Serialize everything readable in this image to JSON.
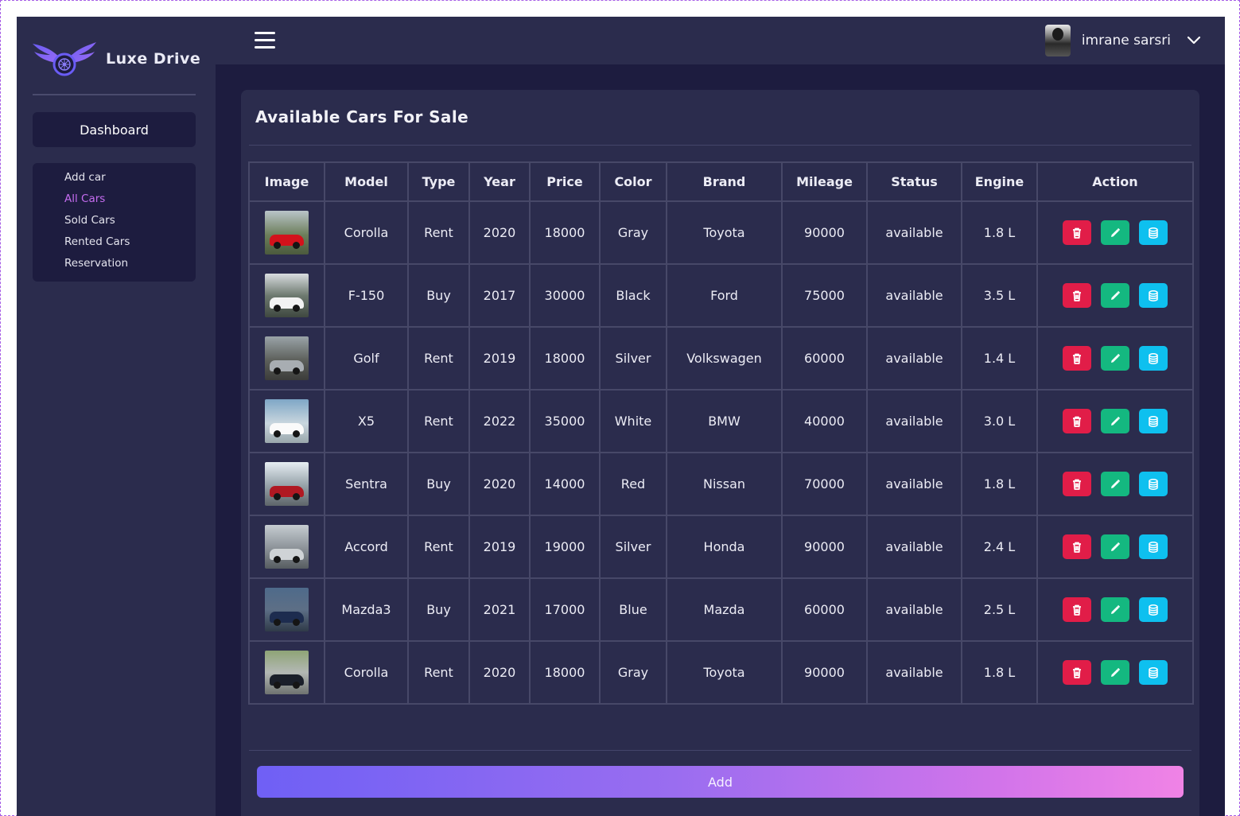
{
  "brand": {
    "name": "Luxe Drive"
  },
  "sidebar": {
    "dashboard_label": "Dashboard",
    "items": [
      {
        "label": "Add car",
        "active": false
      },
      {
        "label": "All Cars",
        "active": true
      },
      {
        "label": "Sold Cars",
        "active": false
      },
      {
        "label": "Rented Cars",
        "active": false
      },
      {
        "label": "Reservation",
        "active": false
      }
    ]
  },
  "topbar": {
    "user_name": "imrane sarsri"
  },
  "page": {
    "title": "Available Cars For Sale",
    "add_label": "Add"
  },
  "table": {
    "headers": [
      "Image",
      "Model",
      "Type",
      "Year",
      "Price",
      "Color",
      "Brand",
      "Mileage",
      "Status",
      "Engine",
      "Action"
    ],
    "rows": [
      {
        "model": "Corolla",
        "type": "Rent",
        "year": "2020",
        "price": "18000",
        "color": "Gray",
        "brand": "Toyota",
        "mileage": "90000",
        "status": "available",
        "engine": "1.8 L"
      },
      {
        "model": "F-150",
        "type": "Buy",
        "year": "2017",
        "price": "30000",
        "color": "Black",
        "brand": "Ford",
        "mileage": "75000",
        "status": "available",
        "engine": "3.5 L"
      },
      {
        "model": "Golf",
        "type": "Rent",
        "year": "2019",
        "price": "18000",
        "color": "Silver",
        "brand": "Volkswagen",
        "mileage": "60000",
        "status": "available",
        "engine": "1.4 L"
      },
      {
        "model": "X5",
        "type": "Rent",
        "year": "2022",
        "price": "35000",
        "color": "White",
        "brand": "BMW",
        "mileage": "40000",
        "status": "available",
        "engine": "3.0 L"
      },
      {
        "model": "Sentra",
        "type": "Buy",
        "year": "2020",
        "price": "14000",
        "color": "Red",
        "brand": "Nissan",
        "mileage": "70000",
        "status": "available",
        "engine": "1.8 L"
      },
      {
        "model": "Accord",
        "type": "Rent",
        "year": "2019",
        "price": "19000",
        "color": "Silver",
        "brand": "Honda",
        "mileage": "90000",
        "status": "available",
        "engine": "2.4 L"
      },
      {
        "model": "Mazda3",
        "type": "Buy",
        "year": "2021",
        "price": "17000",
        "color": "Blue",
        "brand": "Mazda",
        "mileage": "60000",
        "status": "available",
        "engine": "2.5 L"
      },
      {
        "model": "Corolla",
        "type": "Rent",
        "year": "2020",
        "price": "18000",
        "color": "Gray",
        "brand": "Toyota",
        "mileage": "90000",
        "status": "available",
        "engine": "1.8 L"
      }
    ]
  },
  "icons": {
    "delete": "trash-icon",
    "edit": "pencil-icon",
    "details": "database-icon",
    "menu": "hamburger-icon",
    "dropdown": "chevron-down-icon"
  },
  "colors": {
    "background": "#1d1c3f",
    "panel": "#2b2c4d",
    "accent_active": "#c56cf0",
    "delete": "#e11d48",
    "edit": "#14b880",
    "details": "#0ec0ef"
  }
}
